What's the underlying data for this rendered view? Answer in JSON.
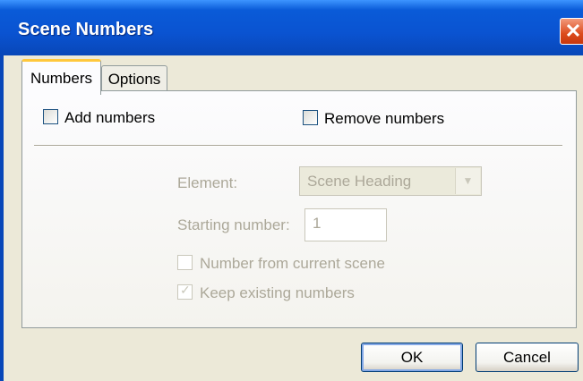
{
  "window": {
    "title": "Scene Numbers",
    "close_glyph": "✕"
  },
  "tabs": [
    {
      "label": "Numbers",
      "active": true
    },
    {
      "label": "Options",
      "active": false
    }
  ],
  "numbers_tab": {
    "add_numbers": {
      "label": "Add numbers",
      "checked": false
    },
    "remove_numbers": {
      "label": "Remove numbers",
      "checked": false
    },
    "element": {
      "label": "Element:",
      "value": "Scene Heading",
      "arrow": "▼"
    },
    "starting_number": {
      "label": "Starting number:",
      "value": "1"
    },
    "number_from_current_scene": {
      "label": "Number from current scene",
      "checked": false
    },
    "keep_existing_numbers": {
      "label": "Keep existing numbers",
      "checked": true,
      "tick": "✓"
    }
  },
  "buttons": {
    "ok": "OK",
    "cancel": "Cancel"
  },
  "colors": {
    "titlebar": "#0a53d1",
    "dialog_bg": "#ece9d8",
    "active_tab_accent": "#ffc83c",
    "disabled_text": "#aca899"
  }
}
